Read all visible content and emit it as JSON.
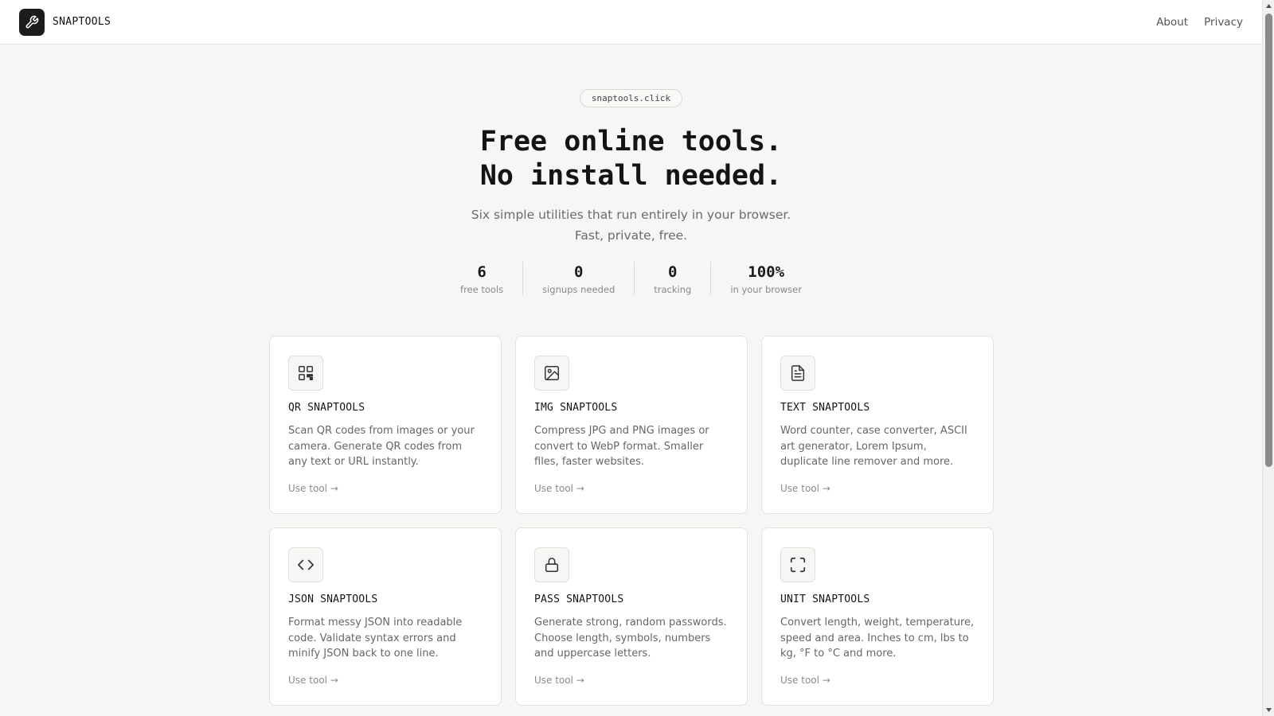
{
  "header": {
    "brand": "SNAPTOOLS",
    "logo_icon": "wrench-icon",
    "nav": [
      {
        "label": "About"
      },
      {
        "label": "Privacy"
      }
    ]
  },
  "hero": {
    "domain": "snaptools.click",
    "headline_line1": "Free online tools.",
    "headline_line2": "No install needed.",
    "subtitle": "Six simple utilities that run entirely in your browser. Fast, private, free."
  },
  "stats": [
    {
      "value": "6",
      "label": "free tools"
    },
    {
      "value": "0",
      "label": "signups needed"
    },
    {
      "value": "0",
      "label": "tracking"
    },
    {
      "value": "100%",
      "label": "in your browser"
    }
  ],
  "tools": [
    {
      "title": "QR SNAPTOOLS",
      "icon": "qr-code-icon",
      "description": "Scan QR codes from images or your camera. Generate QR codes from any text or URL instantly.",
      "link": "Use tool →"
    },
    {
      "title": "IMG SNAPTOOLS",
      "icon": "image-icon",
      "description": "Compress JPG and PNG images or convert to WebP format. Smaller files, faster websites.",
      "link": "Use tool →"
    },
    {
      "title": "TEXT SNAPTOOLS",
      "icon": "document-icon",
      "description": "Word counter, case converter, ASCII art generator, Lorem Ipsum, duplicate line remover and more.",
      "link": "Use tool →"
    },
    {
      "title": "JSON SNAPTOOLS",
      "icon": "code-brackets-icon",
      "description": "Format messy JSON into readable code. Validate syntax errors and minify JSON back to one line.",
      "link": "Use tool →"
    },
    {
      "title": "PASS SNAPTOOLS",
      "icon": "lock-icon",
      "description": "Generate strong, random passwords. Choose length, symbols, numbers and uppercase letters.",
      "link": "Use tool →"
    },
    {
      "title": "UNIT SNAPTOOLS",
      "icon": "expand-frame-icon",
      "description": "Convert length, weight, temperature, speed and area. Inches to cm, lbs to kg, °F to °C and more.",
      "link": "Use tool →"
    }
  ],
  "colors": {
    "background": "#f6f6f4",
    "card": "#ffffff",
    "text": "#1a1a1a",
    "muted": "#6b6b6b",
    "logo_bg": "#1c1c1c"
  }
}
